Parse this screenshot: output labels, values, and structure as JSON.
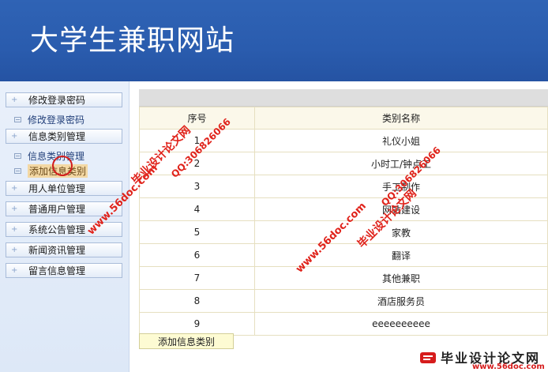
{
  "header": {
    "title": "大学生兼职网站"
  },
  "sidebar": {
    "items": [
      {
        "label": "修改登录密码"
      },
      {
        "label": "信息类别管理"
      },
      {
        "label": "用人单位管理"
      },
      {
        "label": "普通用户管理"
      },
      {
        "label": "系统公告管理"
      },
      {
        "label": "新闻资讯管理"
      },
      {
        "label": "留言信息管理"
      }
    ],
    "subitems": [
      {
        "label": "修改登录密码"
      },
      {
        "label": "信息类别管理"
      },
      {
        "label": "添加信息类别"
      }
    ]
  },
  "table": {
    "headers": [
      "序号",
      "类别名称"
    ],
    "rows": [
      {
        "id": "1",
        "name": "礼仪小姐"
      },
      {
        "id": "2",
        "name": "小时工/钟点工"
      },
      {
        "id": "3",
        "name": "手工制作"
      },
      {
        "id": "4",
        "name": "网站建设"
      },
      {
        "id": "5",
        "name": "家教"
      },
      {
        "id": "6",
        "name": "翻译"
      },
      {
        "id": "7",
        "name": "其他兼职"
      },
      {
        "id": "8",
        "name": "酒店服务员"
      },
      {
        "id": "9",
        "name": "eeeeeeeeee"
      }
    ]
  },
  "actions": {
    "add_label": "添加信息类别"
  },
  "watermark": {
    "cn": "毕业设计论文网",
    "qq": "QQ:306826066",
    "url": "www.56doc.com",
    "footer_cn": "毕业设计论文网",
    "footer_url": "www.56doc.com"
  },
  "colors": {
    "banner": "#2a5cae",
    "watermark": "#e0231b",
    "table_border": "#e6dfc0"
  }
}
